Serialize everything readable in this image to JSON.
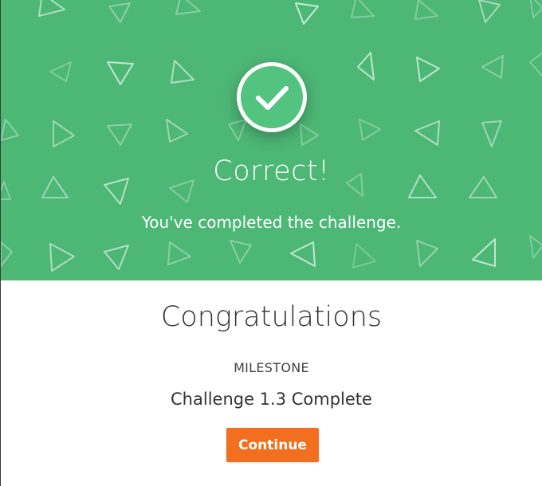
{
  "hero": {
    "title": "Correct!",
    "subtitle": "You've completed the challenge.",
    "icon": "checkmark-icon",
    "background_color": "#4db776",
    "badge_color": "#52c47f"
  },
  "body": {
    "heading": "Congratulations",
    "milestone_label": "MILESTONE",
    "milestone_value": "Challenge 1.3 Complete"
  },
  "actions": {
    "continue_label": "Continue",
    "continue_color": "#f26f1f"
  }
}
